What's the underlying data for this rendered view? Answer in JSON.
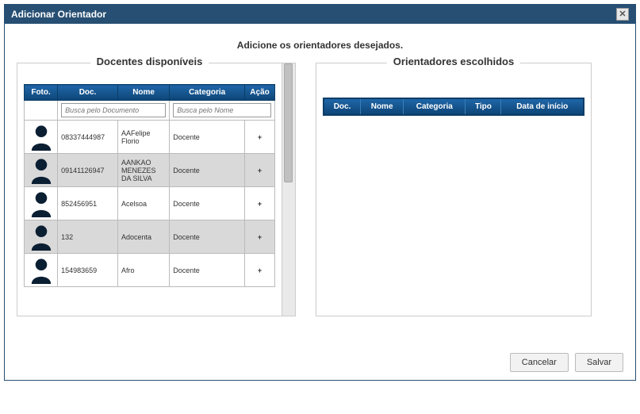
{
  "dialog": {
    "title": "Adicionar Orientador",
    "instruction": "Adicione os orientadores desejados."
  },
  "left_panel": {
    "title": "Docentes disponíveis",
    "search": {
      "doc_placeholder": "Busca pelo Documento",
      "nome_placeholder": "Busca pelo Nome"
    },
    "columns": {
      "foto": "Foto.",
      "doc": "Doc.",
      "nome": "Nome",
      "categoria": "Categoria",
      "acao": "Ação"
    },
    "rows": [
      {
        "doc": "08337444987",
        "nome": "AAFelipe Florio",
        "categoria": "Docente"
      },
      {
        "doc": "09141126947",
        "nome": "AANKAO MENEZES DA SILVA",
        "categoria": "Docente"
      },
      {
        "doc": "852456951",
        "nome": "Acelsoa",
        "categoria": "Docente"
      },
      {
        "doc": "132",
        "nome": "Adocenta",
        "categoria": "Docente"
      },
      {
        "doc": "154983659",
        "nome": "Afro",
        "categoria": "Docente"
      }
    ],
    "action_icon": "+"
  },
  "right_panel": {
    "title": "Orientadores escolhidos",
    "columns": {
      "doc": "Doc.",
      "nome": "Nome",
      "categoria": "Categoria",
      "tipo": "Tipo",
      "data_inicio": "Data de início"
    }
  },
  "footer": {
    "cancel": "Cancelar",
    "save": "Salvar"
  }
}
